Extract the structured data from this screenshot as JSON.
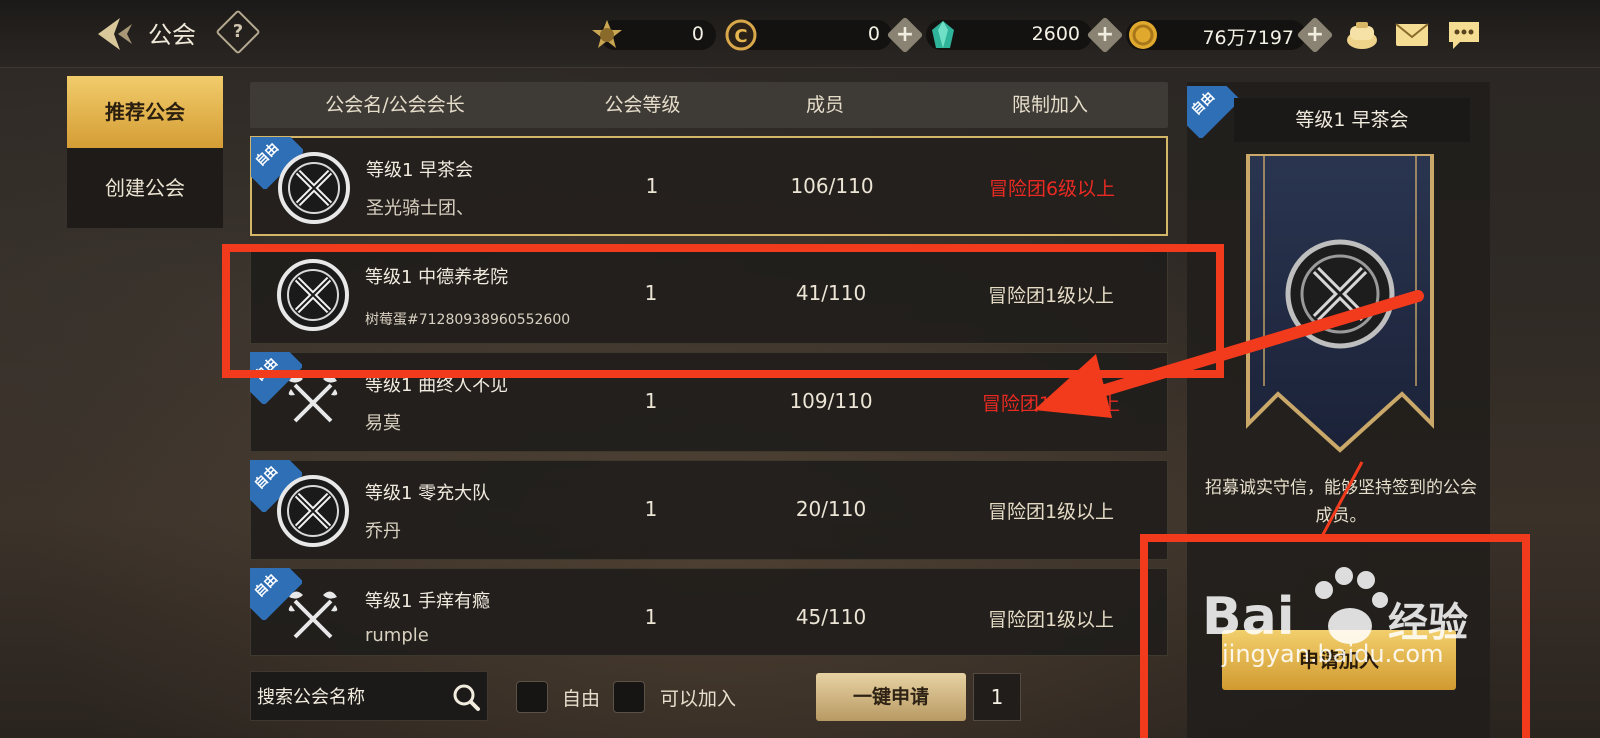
{
  "header": {
    "title": "公会",
    "help": "?"
  },
  "currencies": [
    {
      "icon": "gold-emblem-icon",
      "value": "0"
    },
    {
      "icon": "coin-c-icon",
      "value": "0"
    },
    {
      "icon": "green-gem-icon",
      "value": "2600"
    },
    {
      "icon": "gold-coin-icon",
      "value": "76万7197"
    }
  ],
  "plus": "+",
  "top_icons": [
    "bag-icon",
    "mail-icon",
    "chat-icon"
  ],
  "tabs": [
    {
      "label": "推荐公会",
      "active": true
    },
    {
      "label": "创建公会",
      "active": false
    }
  ],
  "table": {
    "headers": [
      "公会名/公会会长",
      "公会等级",
      "成员",
      "限制加入"
    ],
    "rows": [
      {
        "free": "自由",
        "name": "等级1 早茶会",
        "leader": "圣光骑士团、",
        "level": "1",
        "members": "106/110",
        "limit": "冒险团6级以上",
        "limit_color": "red",
        "emblem": "swords-emblem-icon",
        "selected": true
      },
      {
        "free": "",
        "name": "等级1 中德养老院",
        "leader": "树莓蛋#71280938960552600",
        "level": "1",
        "members": "41/110",
        "limit": "冒险团1级以上",
        "limit_color": "normal",
        "emblem": "swords-emblem-icon",
        "selected": false
      },
      {
        "free": "自由",
        "name": "等级1 曲终人不见",
        "leader": "易莫",
        "level": "1",
        "members": "109/110",
        "limit": "冒险团10级以上",
        "limit_color": "red",
        "emblem": "axes-emblem-icon",
        "selected": false
      },
      {
        "free": "自由",
        "name": "等级1 零充大队",
        "leader": "乔丹",
        "level": "1",
        "members": "20/110",
        "limit": "冒险团1级以上",
        "limit_color": "normal",
        "emblem": "swords-emblem-icon",
        "selected": false
      },
      {
        "free": "自由",
        "name": "等级1 手痒有瘾",
        "leader": "rumple",
        "level": "1",
        "members": "45/110",
        "limit": "冒险团1级以上",
        "limit_color": "normal",
        "emblem": "axes-emblem-icon",
        "selected": false
      }
    ]
  },
  "bottom": {
    "search_placeholder": "搜索公会名称",
    "filter_free": "自由",
    "filter_joinable": "可以加入",
    "apply_all": "一键申请",
    "page": "1"
  },
  "detail": {
    "free": "自由",
    "title": "等级1 早茶会",
    "description": "招募诚实守信，能够坚持签到的公会成员。",
    "join_button": "申请加入"
  },
  "watermark": {
    "brand": "Bai du 经验",
    "url": "jingyan.baidu.com"
  },
  "colors": {
    "accent_gold": "#d59d35",
    "limit_red": "#ea2a22",
    "annotation_red": "#f23a1c",
    "free_badge_blue": "#2f6fb6"
  }
}
